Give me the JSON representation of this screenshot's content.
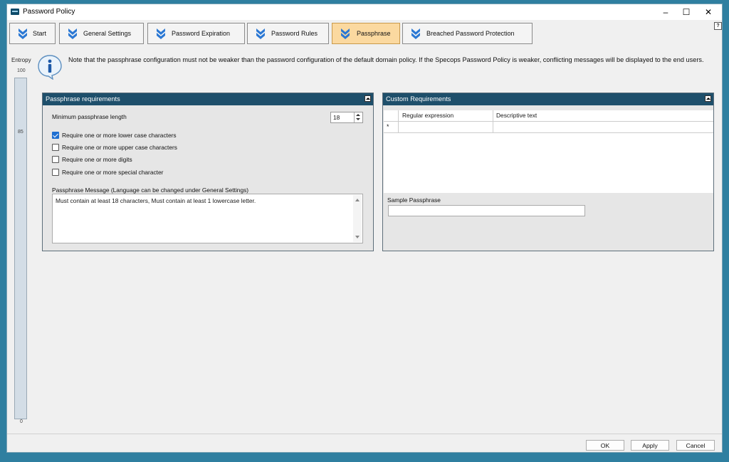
{
  "window": {
    "title": "Password Policy"
  },
  "tabs": [
    {
      "label": "Start",
      "active": false
    },
    {
      "label": "General Settings",
      "active": false
    },
    {
      "label": "Password Expiration",
      "active": false
    },
    {
      "label": "Password Rules",
      "active": false
    },
    {
      "label": "Passphrase",
      "active": true
    },
    {
      "label": "Breached Password Protection",
      "active": false
    }
  ],
  "entropy": {
    "label": "Entropy",
    "max": "100",
    "current": "85",
    "min": "0"
  },
  "note": "Note that the passphrase configuration must not be weaker than the password configuration of the default domain policy. If the Specops Password Policy is weaker, conflicting messages will be displayed to the end users.",
  "passphrase_panel": {
    "title": "Passphrase requirements",
    "min_length_label": "Minimum passphrase length",
    "min_length_value": "18",
    "checkboxes": [
      {
        "label": "Require one or more lower case characters",
        "checked": true
      },
      {
        "label": "Require one or more upper case characters",
        "checked": false
      },
      {
        "label": "Require one or more digits",
        "checked": false
      },
      {
        "label": "Require one or more special character",
        "checked": false
      }
    ],
    "message_label": "Passphrase Message (Language can be changed under General Settings)",
    "message_value": "Must contain at least 18 characters, Must contain at least 1 lowercase letter."
  },
  "custom_panel": {
    "title": "Custom Requirements",
    "columns": [
      "Regular expression",
      "Descriptive text"
    ],
    "new_row_marker": "*",
    "sample_label": "Sample Passphrase",
    "sample_value": ""
  },
  "buttons": {
    "ok": "OK",
    "apply": "Apply",
    "cancel": "Cancel"
  },
  "colors": {
    "panel_header": "#1e4f6b",
    "active_tab": "#fbd9a0",
    "checkbox_checked": "#1f6fd1"
  }
}
